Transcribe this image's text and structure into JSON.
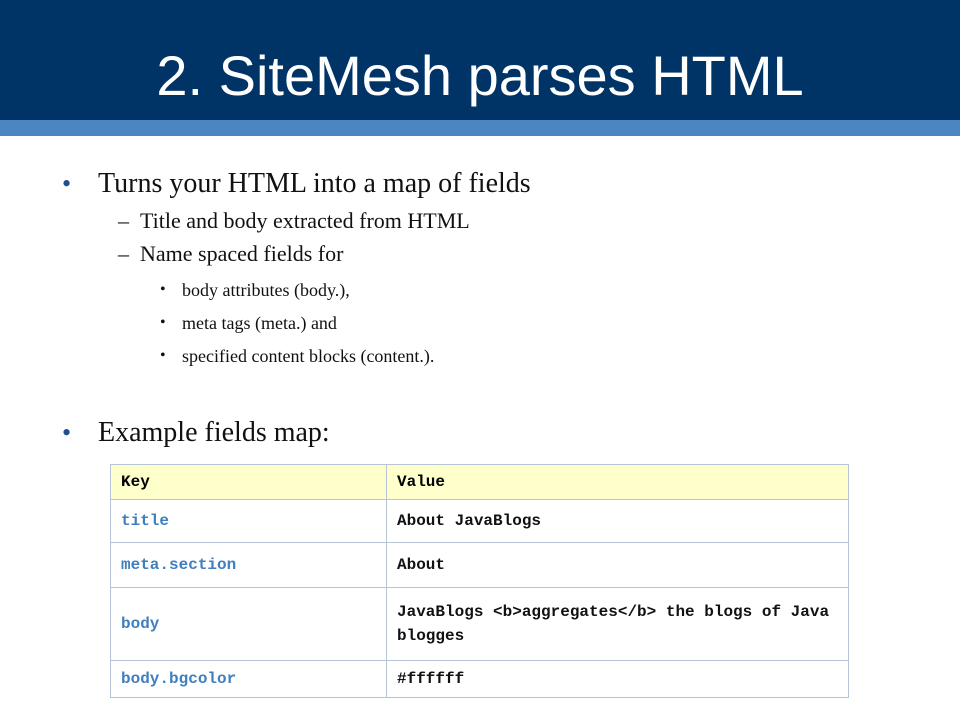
{
  "slide": {
    "title": "2. SiteMesh parses HTML"
  },
  "bullets": {
    "b1": "Turns your HTML into a map of fields",
    "b1_sub1": "Title and body extracted from HTML",
    "b1_sub2": "Name spaced fields for",
    "b1_sub2_items": [
      "body attributes (body.),",
      "meta tags (meta.) and",
      "specified content blocks (content.)."
    ],
    "b2": "Example fields map:"
  },
  "glyphs": {
    "bullet": "•",
    "dash": "–"
  },
  "table": {
    "headers": [
      "Key",
      "Value"
    ],
    "rows": [
      {
        "key": "title",
        "value": "About JavaBlogs"
      },
      {
        "key": "meta.section",
        "value": "About"
      },
      {
        "key": "body",
        "value": "JavaBlogs <b>aggregates</b> the blogs of Java blogges"
      },
      {
        "key": "body.bgcolor",
        "value": "#ffffff"
      }
    ]
  },
  "colors": {
    "header_band": "#003366",
    "header_stripe": "#4b86c3",
    "table_header_bg": "#ffffcc",
    "key_text": "#3f7fbf"
  }
}
